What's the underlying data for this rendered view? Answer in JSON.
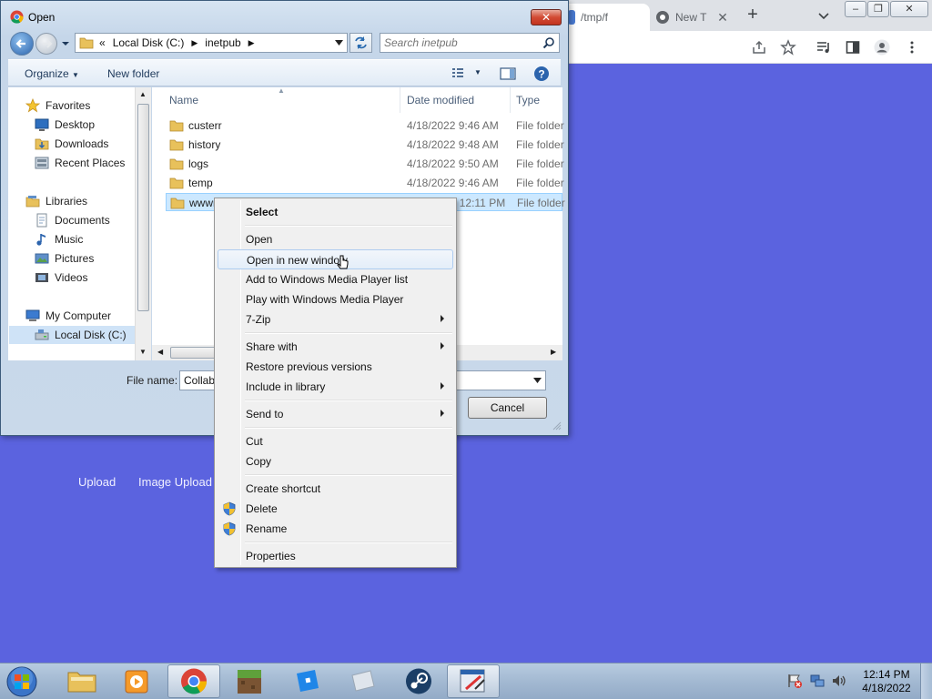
{
  "browser": {
    "tabs": [
      {
        "title": "/tmp/f"
      },
      {
        "title": "New T"
      }
    ],
    "new_tab_symbol": "+",
    "close_symbol": "✕",
    "toolbar_icons": [
      "share-icon",
      "bookmark-star-icon",
      "media-control-icon",
      "side-panel-icon",
      "profile-icon",
      "kebab-menu-icon"
    ]
  },
  "page": {
    "links": {
      "upload": "Upload",
      "image_upload": "Image Upload"
    }
  },
  "dialog": {
    "title": "Open",
    "breadcrumb": {
      "overflow": "«",
      "items": [
        "Local Disk (C:)",
        "inetpub"
      ]
    },
    "search_placeholder": "Search inetpub",
    "commands": {
      "organize": "Organize",
      "new_folder": "New folder"
    },
    "nav": {
      "favorites": "Favorites",
      "desktop": "Desktop",
      "downloads": "Downloads",
      "recent_places": "Recent Places",
      "libraries": "Libraries",
      "documents": "Documents",
      "music": "Music",
      "pictures": "Pictures",
      "videos": "Videos",
      "my_computer": "My Computer",
      "local_disk": "Local Disk (C:)"
    },
    "columns": {
      "name": "Name",
      "date": "Date modified",
      "type": "Type"
    },
    "files": [
      {
        "name": "custerr",
        "date": "4/18/2022 9:46 AM",
        "type": "File folder"
      },
      {
        "name": "history",
        "date": "4/18/2022 9:48 AM",
        "type": "File folder"
      },
      {
        "name": "logs",
        "date": "4/18/2022 9:50 AM",
        "type": "File folder"
      },
      {
        "name": "temp",
        "date": "4/18/2022 9:46 AM",
        "type": "File folder"
      },
      {
        "name": "wwwroot",
        "date": "4/18/2022 12:11 PM",
        "type": "File folder"
      }
    ],
    "file_name_label": "File name:",
    "file_name_value": "Collab",
    "cancel": "Cancel"
  },
  "context_menu": {
    "select": "Select",
    "open": "Open",
    "open_new_window": "Open in new window",
    "add_wmp_list": "Add to Windows Media Player list",
    "play_wmp": "Play with Windows Media Player",
    "sevenzip": "7-Zip",
    "share_with": "Share with",
    "restore_versions": "Restore previous versions",
    "include_library": "Include in library",
    "send_to": "Send to",
    "cut": "Cut",
    "copy": "Copy",
    "create_shortcut": "Create shortcut",
    "delete": "Delete",
    "rename": "Rename",
    "properties": "Properties"
  },
  "taskbar": {
    "apps": [
      "file-explorer-icon",
      "media-player-icon",
      "chrome-icon",
      "minecraft-icon",
      "roblox-icon",
      "blank-app-icon",
      "steam-icon",
      "paint-app-icon"
    ],
    "time": "12:14 PM",
    "date": "4/18/2022"
  },
  "colors": {
    "page_background": "#5b63df",
    "menu_highlight": "#aeccf0",
    "selection": "#cce8ff"
  }
}
